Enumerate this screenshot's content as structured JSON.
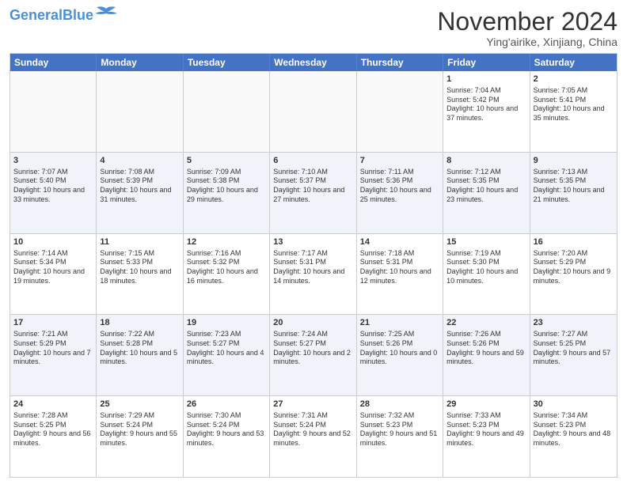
{
  "header": {
    "logo_line1": "General",
    "logo_line2": "Blue",
    "month": "November 2024",
    "location": "Ying'airike, Xinjiang, China"
  },
  "weekdays": [
    "Sunday",
    "Monday",
    "Tuesday",
    "Wednesday",
    "Thursday",
    "Friday",
    "Saturday"
  ],
  "rows": [
    [
      {
        "day": "",
        "info": ""
      },
      {
        "day": "",
        "info": ""
      },
      {
        "day": "",
        "info": ""
      },
      {
        "day": "",
        "info": ""
      },
      {
        "day": "",
        "info": ""
      },
      {
        "day": "1",
        "info": "Sunrise: 7:04 AM\nSunset: 5:42 PM\nDaylight: 10 hours and 37 minutes."
      },
      {
        "day": "2",
        "info": "Sunrise: 7:05 AM\nSunset: 5:41 PM\nDaylight: 10 hours and 35 minutes."
      }
    ],
    [
      {
        "day": "3",
        "info": "Sunrise: 7:07 AM\nSunset: 5:40 PM\nDaylight: 10 hours and 33 minutes."
      },
      {
        "day": "4",
        "info": "Sunrise: 7:08 AM\nSunset: 5:39 PM\nDaylight: 10 hours and 31 minutes."
      },
      {
        "day": "5",
        "info": "Sunrise: 7:09 AM\nSunset: 5:38 PM\nDaylight: 10 hours and 29 minutes."
      },
      {
        "day": "6",
        "info": "Sunrise: 7:10 AM\nSunset: 5:37 PM\nDaylight: 10 hours and 27 minutes."
      },
      {
        "day": "7",
        "info": "Sunrise: 7:11 AM\nSunset: 5:36 PM\nDaylight: 10 hours and 25 minutes."
      },
      {
        "day": "8",
        "info": "Sunrise: 7:12 AM\nSunset: 5:35 PM\nDaylight: 10 hours and 23 minutes."
      },
      {
        "day": "9",
        "info": "Sunrise: 7:13 AM\nSunset: 5:35 PM\nDaylight: 10 hours and 21 minutes."
      }
    ],
    [
      {
        "day": "10",
        "info": "Sunrise: 7:14 AM\nSunset: 5:34 PM\nDaylight: 10 hours and 19 minutes."
      },
      {
        "day": "11",
        "info": "Sunrise: 7:15 AM\nSunset: 5:33 PM\nDaylight: 10 hours and 18 minutes."
      },
      {
        "day": "12",
        "info": "Sunrise: 7:16 AM\nSunset: 5:32 PM\nDaylight: 10 hours and 16 minutes."
      },
      {
        "day": "13",
        "info": "Sunrise: 7:17 AM\nSunset: 5:31 PM\nDaylight: 10 hours and 14 minutes."
      },
      {
        "day": "14",
        "info": "Sunrise: 7:18 AM\nSunset: 5:31 PM\nDaylight: 10 hours and 12 minutes."
      },
      {
        "day": "15",
        "info": "Sunrise: 7:19 AM\nSunset: 5:30 PM\nDaylight: 10 hours and 10 minutes."
      },
      {
        "day": "16",
        "info": "Sunrise: 7:20 AM\nSunset: 5:29 PM\nDaylight: 10 hours and 9 minutes."
      }
    ],
    [
      {
        "day": "17",
        "info": "Sunrise: 7:21 AM\nSunset: 5:29 PM\nDaylight: 10 hours and 7 minutes."
      },
      {
        "day": "18",
        "info": "Sunrise: 7:22 AM\nSunset: 5:28 PM\nDaylight: 10 hours and 5 minutes."
      },
      {
        "day": "19",
        "info": "Sunrise: 7:23 AM\nSunset: 5:27 PM\nDaylight: 10 hours and 4 minutes."
      },
      {
        "day": "20",
        "info": "Sunrise: 7:24 AM\nSunset: 5:27 PM\nDaylight: 10 hours and 2 minutes."
      },
      {
        "day": "21",
        "info": "Sunrise: 7:25 AM\nSunset: 5:26 PM\nDaylight: 10 hours and 0 minutes."
      },
      {
        "day": "22",
        "info": "Sunrise: 7:26 AM\nSunset: 5:26 PM\nDaylight: 9 hours and 59 minutes."
      },
      {
        "day": "23",
        "info": "Sunrise: 7:27 AM\nSunset: 5:25 PM\nDaylight: 9 hours and 57 minutes."
      }
    ],
    [
      {
        "day": "24",
        "info": "Sunrise: 7:28 AM\nSunset: 5:25 PM\nDaylight: 9 hours and 56 minutes."
      },
      {
        "day": "25",
        "info": "Sunrise: 7:29 AM\nSunset: 5:24 PM\nDaylight: 9 hours and 55 minutes."
      },
      {
        "day": "26",
        "info": "Sunrise: 7:30 AM\nSunset: 5:24 PM\nDaylight: 9 hours and 53 minutes."
      },
      {
        "day": "27",
        "info": "Sunrise: 7:31 AM\nSunset: 5:24 PM\nDaylight: 9 hours and 52 minutes."
      },
      {
        "day": "28",
        "info": "Sunrise: 7:32 AM\nSunset: 5:23 PM\nDaylight: 9 hours and 51 minutes."
      },
      {
        "day": "29",
        "info": "Sunrise: 7:33 AM\nSunset: 5:23 PM\nDaylight: 9 hours and 49 minutes."
      },
      {
        "day": "30",
        "info": "Sunrise: 7:34 AM\nSunset: 5:23 PM\nDaylight: 9 hours and 48 minutes."
      }
    ]
  ]
}
